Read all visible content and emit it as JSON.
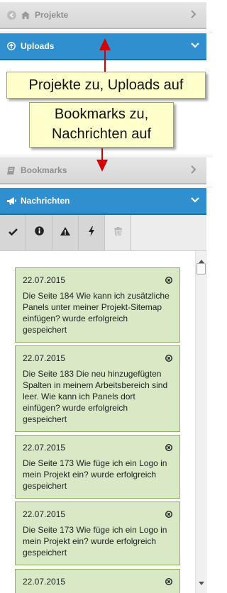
{
  "panels": {
    "projekte": {
      "label": "Projekte",
      "icon": "home-icon"
    },
    "uploads": {
      "label": "Uploads",
      "icon": "upload-circle-icon"
    },
    "bookmarks": {
      "label": "Bookmarks",
      "icon": "book-icon"
    },
    "nachrichten": {
      "label": "Nachrichten",
      "icon": "megaphone-icon"
    }
  },
  "toolbar": {
    "buttons": [
      {
        "icon": "check-icon"
      },
      {
        "icon": "info-icon"
      },
      {
        "icon": "warning-icon"
      },
      {
        "icon": "lightning-icon"
      },
      {
        "icon": "trash-icon"
      }
    ]
  },
  "messages": [
    {
      "date": "22.07.2015",
      "text": "Die Seite 184 Wie kann ich zusätzliche Panels unter meiner Projekt-Sitemap einfügen? wurde erfolgreich gespeichert"
    },
    {
      "date": "22.07.2015",
      "text": "Die Seite 183 Die neu hinzugefügten Spalten in meinem Arbeitsbereich sind leer. Wie kann ich Panels dort einfügen? wurde erfolgreich gespeichert"
    },
    {
      "date": "22.07.2015",
      "text": "Die Seite 173 Wie füge ich ein Logo in mein Projekt ein? wurde erfolgreich gespeichert"
    },
    {
      "date": "22.07.2015",
      "text": "Die Seite 173 Wie füge ich ein Logo in mein Projekt ein? wurde erfolgreich gespeichert"
    },
    {
      "date": "22.07.2015",
      "text": ""
    }
  ],
  "annotations": {
    "note1": "Projekte zu, Uploads auf",
    "note2_line1": "Bookmarks zu,",
    "note2_line2": "Nachrichten auf"
  },
  "colors": {
    "header_blue": "#2f8fcf",
    "card_green": "#d9e9c6",
    "card_border": "#8db35b",
    "note_yellow": "#ffffcc",
    "arrow_red": "#d40000"
  }
}
